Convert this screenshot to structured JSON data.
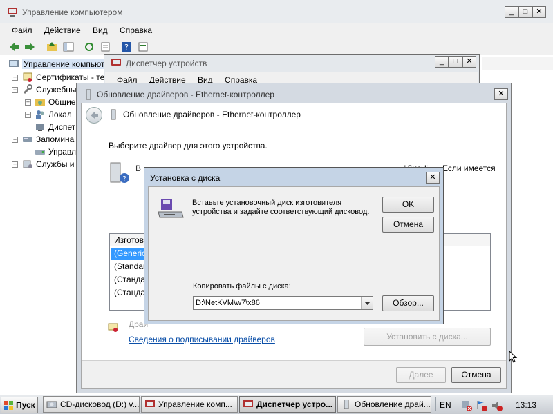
{
  "main_window": {
    "title": "Управление компьютером",
    "menu": [
      "Файл",
      "Действие",
      "Вид",
      "Справка"
    ],
    "tree": [
      "Управление компьют",
      "Сертификаты - те",
      "Служебны",
      "Общие",
      "Локал",
      "Диспет",
      "Запомина",
      "Управл",
      "Службы и"
    ]
  },
  "device_manager": {
    "title": "Диспетчер устройств",
    "menu": [
      "Файл",
      "Действие",
      "Вид",
      "Справка"
    ]
  },
  "update_driver": {
    "title": "Обновление драйверов - Ethernet-контроллер",
    "header": "Обновление драйверов - Ethernet-контроллер",
    "prompt": "Выберите драйвер для этого устройства.",
    "desc_partial_left": "В",
    "desc_partial_right": "\"Диск\"",
    "desc_partial_right2": "Если имеется",
    "list_header": "Изготов",
    "list_items": [
      "(Generic",
      "(Standar",
      "(Станда",
      "(Станда"
    ],
    "signed_partial": "Драй",
    "signing_link": "Сведения о подписывании драйверов",
    "install_from_disk": "Установить с диска...",
    "next": "Далее",
    "cancel": "Отмена"
  },
  "disk_dialog": {
    "title": "Установка с диска",
    "message_line1": "Вставьте установочный диск изготовителя",
    "message_line2": "устройства и задайте соответствующий дисковод.",
    "ok": "OK",
    "cancel": "Отмена",
    "copy_label": "Копировать файлы с диска:",
    "path_value": "D:\\NetKVM\\w7\\x86",
    "browse": "Обзор..."
  },
  "taskbar": {
    "start": "Пуск",
    "items": [
      "CD-дисковод (D:) v...",
      "Управление комп...",
      "Диспетчер устро...",
      "Обновление драй..."
    ],
    "lang": "EN",
    "clock": "13:13"
  },
  "window_controls": {
    "minimize": "_",
    "maximize": "□",
    "close": "✕"
  }
}
